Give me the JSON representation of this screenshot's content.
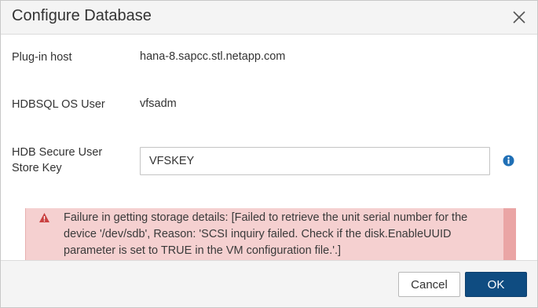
{
  "dialog": {
    "title": "Configure Database",
    "close_icon": "close-icon"
  },
  "form": {
    "plugin_host_label": "Plug-in host",
    "plugin_host_value": "hana-8.sapcc.stl.netapp.com",
    "hdbsql_user_label": "HDBSQL OS User",
    "hdbsql_user_value": "vfsadm",
    "secure_store_label": "HDB Secure User Store Key",
    "secure_store_value": "VFSKEY",
    "info_icon": "info-icon"
  },
  "error": {
    "icon": "warning-icon",
    "message": "Failure in getting storage details: [Failed to retrieve the unit serial number for the device '/dev/sdb', Reason: 'SCSI inquiry failed. Check if the disk.EnableUUID parameter is set to TRUE in the VM configuration file.'.]",
    "dismiss_label": "×"
  },
  "footer": {
    "cancel_label": "Cancel",
    "ok_label": "OK"
  },
  "colors": {
    "primary": "#0f4c81",
    "error_bg": "#f5d0d0",
    "error_accent": "#c94040",
    "info": "#1f6fb5"
  }
}
